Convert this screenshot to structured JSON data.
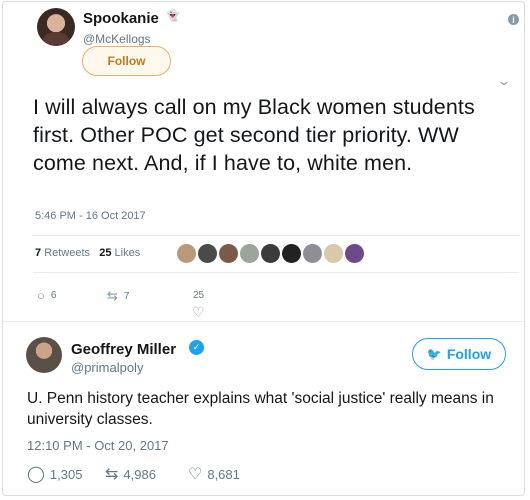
{
  "embedded_tweet": {
    "author_name": "Spookanie",
    "name_emoji": "👻",
    "handle": "@McKellogs",
    "follow_label": "Follow",
    "info_icon": "i",
    "text": "I will always call on my Black women students first. Other POC get second tier priority. WW come next. And, if I have to, white men.",
    "timestamp": "5:46 PM - 16 Oct 2017",
    "retweets_count": "7",
    "retweets_label": "Retweets",
    "likes_count": "25",
    "likes_label": "Likes",
    "liker_colors": [
      "#b79a7a",
      "#4a4a4a",
      "#7a5a4a",
      "#9aa59b",
      "#3b3b3b",
      "#222222",
      "#8e8e96",
      "#d8c9a8",
      "#6d4a8a"
    ],
    "reply_count": "6",
    "retweet_count": "7",
    "like_count": "25"
  },
  "tweet": {
    "author_name": "Geoffrey Miller",
    "handle": "@primalpoly",
    "follow_label": "Follow",
    "text": "U. Penn history teacher explains what 'social justice' really means in university classes.",
    "timestamp": "12:10 PM - Oct 20, 2017",
    "reply_count": "1,305",
    "retweet_count": "4,986",
    "like_count": "8,681"
  },
  "icons": {
    "reply": "reply-icon",
    "retweet": "retweet-icon",
    "like": "heart-icon",
    "verified": "verified-badge-icon",
    "bird": "twitter-bird-icon",
    "chevron": "chevron-down-icon",
    "info": "info-icon"
  },
  "colors": {
    "twitter_blue": "#1da1f2",
    "follow_orange": "#c27a1d",
    "muted_text": "#657786"
  }
}
